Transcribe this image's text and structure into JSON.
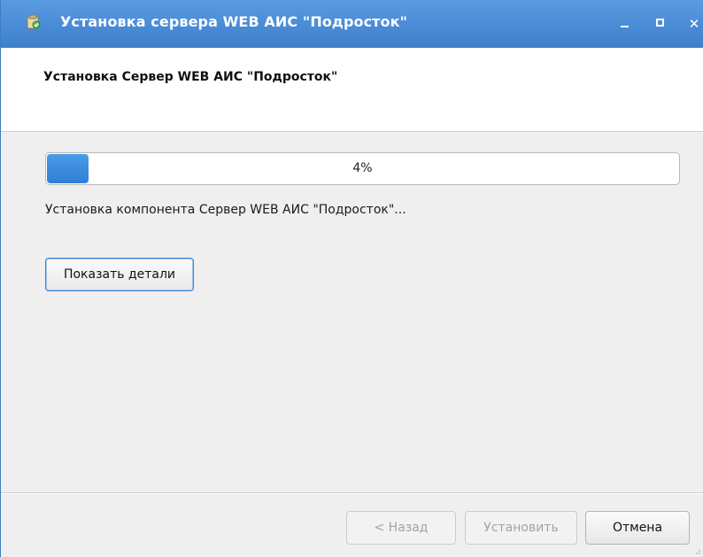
{
  "window": {
    "title": "Установка сервера WEB АИС \"Подросток\"",
    "accent_color": "#4a8bd6"
  },
  "header": {
    "title": "Установка Сервер WEB АИС \"Подросток\""
  },
  "progress": {
    "percent": 4,
    "label": "4%"
  },
  "status": {
    "text": "Установка компонента Сервер WEB АИС \"Подросток\"..."
  },
  "buttons": {
    "details": "Показать детали",
    "back": "< Назад",
    "install": "Установить",
    "cancel": "Отмена"
  },
  "icons": {
    "app": "installer-icon",
    "minimize": "minimize-icon",
    "maximize": "maximize-icon",
    "close": "close-icon"
  }
}
